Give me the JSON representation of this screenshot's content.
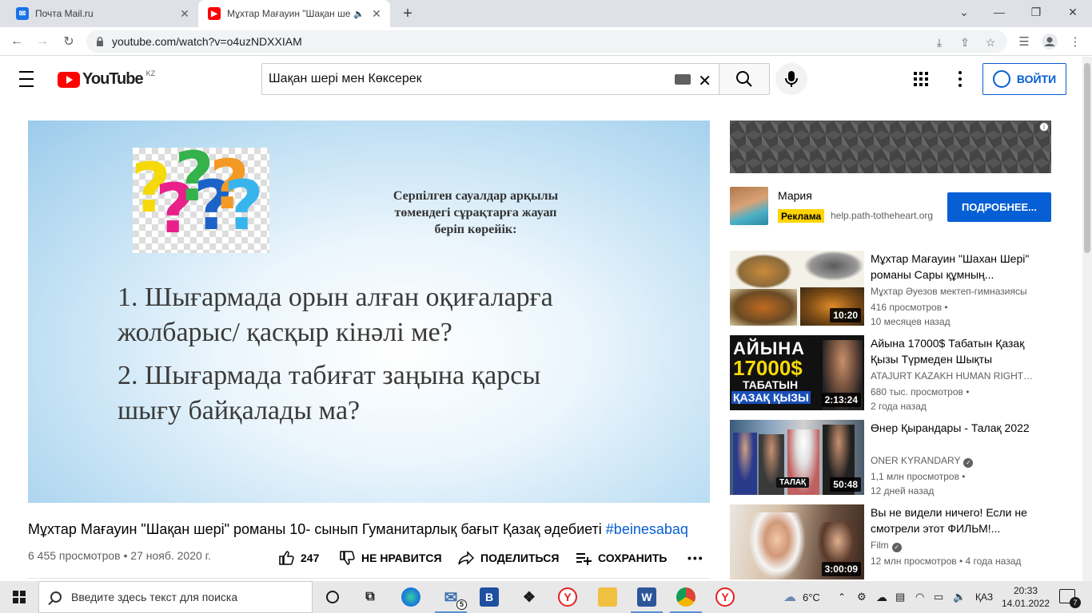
{
  "browser": {
    "tabs": [
      {
        "title": "Почта Mail.ru",
        "active": false
      },
      {
        "title": "Мұхтар Мағауин \"Шақан ше",
        "active": true
      }
    ],
    "url": "youtube.com/watch?v=o4uzNDXXIAM"
  },
  "youtube": {
    "logo_text": "YouTube",
    "region": "KZ",
    "search_query": "Шақан шері мен Көксерек",
    "signin_label": "ВОЙТИ"
  },
  "slide": {
    "subtitle": "Серпілген сауалдар арқылы\nтөмендегі сұрақтарға жауап\nберіп көрейік:",
    "question1": "1. Шығармада орын алған оқиғаларға\nжолбарыс/ қасқыр  кінәлі ме?",
    "question2": "2. Шығармада табиғат заңына қарсы\nшығу байқалады ма?"
  },
  "video": {
    "title": "Мұхтар Мағауин \"Шақан шері\" романы 10- сынып Гуманитарлық бағыт Қазақ әдебиеті ",
    "hashtag": "#beinesabaq",
    "views_date": "6 455 просмотров • 27 нояб. 2020 г.",
    "likes": "247",
    "dislike_label": "НЕ НРАВИТСЯ",
    "share_label": "ПОДЕЛИТЬСЯ",
    "save_label": "СОХРАНИТЬ"
  },
  "ad": {
    "name": "Мария",
    "badge": "Реклама",
    "url": "help.path-totheheart.org",
    "cta": "ПОДРОБНЕЕ..."
  },
  "recommendations": [
    {
      "title": "Мұхтар Мағауин \"Шахан Шері\" романы Сары құмның...",
      "channel": "Мұхтар Әуезов мектеп-гимназиясы",
      "views": "416 просмотров",
      "age": "10 месяцев назад",
      "duration": "10:20",
      "verified": false
    },
    {
      "title": "Айына 17000$ Табатын Қазақ Қызы Түрмеден Шықты",
      "channel": "ATAJURT KAZAKH HUMAN RIGHTS ...",
      "views": "680 тыс. просмотров",
      "age": "2 года назад",
      "duration": "2:13:24",
      "verified": false
    },
    {
      "title": "Өнер Қырандары - Талақ 2022",
      "channel": "ONER KYRANDARY",
      "views": "1,1 млн просмотров",
      "age": "12 дней назад",
      "duration": "50:48",
      "verified": true
    },
    {
      "title": "Вы не видели ничего! Если не смотрели этот ФИЛЬМ!...",
      "channel": "Film",
      "views": "12 млн просмотров",
      "age": "4 года назад",
      "duration": "3:00:09",
      "verified": true
    }
  ],
  "thumb_text": {
    "r2_top": "АЙЫНА",
    "r2_mid": "17000$",
    "r2_sub": "ТАБАТЫН",
    "r2_bottom": "ҚАЗАҚ ҚЫЗЫ",
    "r3_badge": "ТАЛАҚ"
  },
  "taskbar": {
    "search_placeholder": "Введите здесь текст для поиска",
    "weather": "6°C",
    "language": "ҚАЗ",
    "time": "20:33",
    "date": "14.01.2022",
    "notifications": "7",
    "mail_count": "5"
  }
}
